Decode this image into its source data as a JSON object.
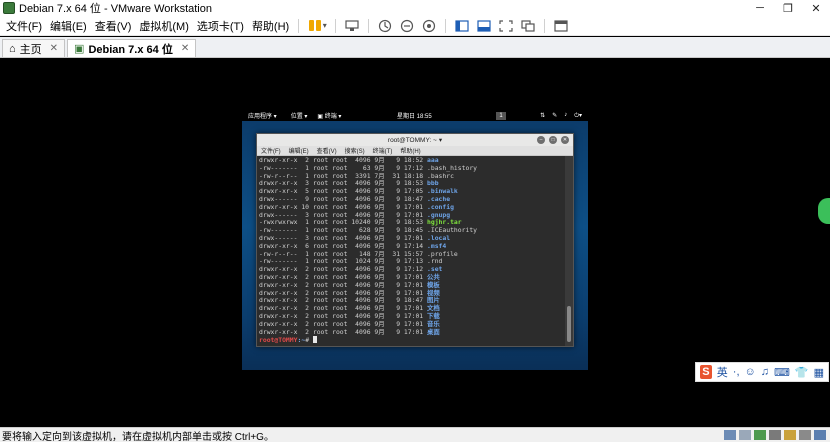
{
  "window": {
    "title": "Debian 7.x 64 位 - VMware Workstation"
  },
  "menu": [
    "文件(F)",
    "编辑(E)",
    "查看(V)",
    "虚拟机(M)",
    "选项卡(T)",
    "帮助(H)"
  ],
  "tabs": [
    {
      "label": "主页"
    },
    {
      "label": "Debian 7.x 64 位"
    }
  ],
  "guest": {
    "panel": {
      "apps": "应用程序 ▾",
      "places": "位置 ▾",
      "terminal": "▣ 终端 ▾",
      "clock": "星期日 18:55",
      "workspace": "1"
    },
    "terminal": {
      "title": "root@TOMMY: ~",
      "menu": [
        "文件(F)",
        "编辑(E)",
        "查看(V)",
        "搜索(S)",
        "终端(T)",
        "帮助(H)"
      ],
      "rows": [
        {
          "meta": "drwxr-xr-x  2 root root  4096 9月   9 18:52 ",
          "name": "aaa",
          "kind": "dir"
        },
        {
          "meta": "-rw-------  1 root root    63 9月   9 17:12 ",
          "name": ".bash_history",
          "kind": "file"
        },
        {
          "meta": "-rw-r--r--  1 root root  3391 7月  31 18:18 ",
          "name": ".bashrc",
          "kind": "file"
        },
        {
          "meta": "drwxr-xr-x  3 root root  4096 9月   9 18:53 ",
          "name": "bbb",
          "kind": "dir"
        },
        {
          "meta": "drwxr-xr-x  5 root root  4096 9月   9 17:05 ",
          "name": ".binwalk",
          "kind": "dir"
        },
        {
          "meta": "drwx------  9 root root  4096 9月   9 18:47 ",
          "name": ".cache",
          "kind": "dir"
        },
        {
          "meta": "drwxr-xr-x 10 root root  4096 9月   9 17:01 ",
          "name": ".config",
          "kind": "dir"
        },
        {
          "meta": "drwx------  3 root root  4096 9月   9 17:01 ",
          "name": ".gnupg",
          "kind": "dir"
        },
        {
          "meta": "-rwxrwxrwx  1 root root 10240 9月   9 18:53 ",
          "name": "hgjhr.tar",
          "kind": "exec"
        },
        {
          "meta": "-rw-------  1 root root   628 9月   9 18:45 ",
          "name": ".ICEauthority",
          "kind": "file"
        },
        {
          "meta": "drwx------  3 root root  4096 9月   9 17:01 ",
          "name": ".local",
          "kind": "dir"
        },
        {
          "meta": "drwxr-xr-x  6 root root  4096 9月   9 17:14 ",
          "name": ".msf4",
          "kind": "dir"
        },
        {
          "meta": "-rw-r--r--  1 root root   148 7月  31 15:57 ",
          "name": ".profile",
          "kind": "file"
        },
        {
          "meta": "-rw-------  1 root root  1024 9月   9 17:13 ",
          "name": ".rnd",
          "kind": "file"
        },
        {
          "meta": "drwxr-xr-x  2 root root  4096 9月   9 17:12 ",
          "name": ".set",
          "kind": "dir"
        },
        {
          "meta": "drwxr-xr-x  2 root root  4096 9月   9 17:01 ",
          "name": "公共",
          "kind": "dir"
        },
        {
          "meta": "drwxr-xr-x  2 root root  4096 9月   9 17:01 ",
          "name": "模板",
          "kind": "dir"
        },
        {
          "meta": "drwxr-xr-x  2 root root  4096 9月   9 17:01 ",
          "name": "视频",
          "kind": "dir"
        },
        {
          "meta": "drwxr-xr-x  2 root root  4096 9月   9 18:47 ",
          "name": "图片",
          "kind": "dir"
        },
        {
          "meta": "drwxr-xr-x  2 root root  4096 9月   9 17:01 ",
          "name": "文档",
          "kind": "dir"
        },
        {
          "meta": "drwxr-xr-x  2 root root  4096 9月   9 17:01 ",
          "name": "下载",
          "kind": "dir"
        },
        {
          "meta": "drwxr-xr-x  2 root root  4096 9月   9 17:01 ",
          "name": "音乐",
          "kind": "dir"
        },
        {
          "meta": "drwxr-xr-x  2 root root  4096 9月   9 17:01 ",
          "name": "桌面",
          "kind": "dir"
        }
      ],
      "prompt": {
        "user": "root@TOMMY",
        "path": ":~",
        "symbol": "# "
      }
    }
  },
  "ime": {
    "lang": "英"
  },
  "status": {
    "text": "要将输入定向到该虚拟机，请在虚拟机内部单击或按 Ctrl+G。"
  },
  "colors": {
    "accent": "#f0a800",
    "desktop": "#0d4f86",
    "prompt_user": "#e04a4a"
  }
}
